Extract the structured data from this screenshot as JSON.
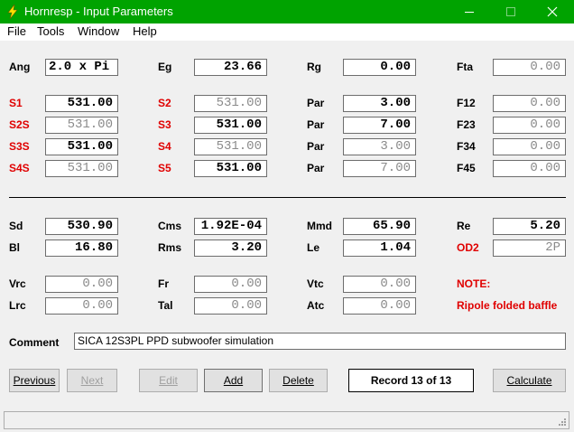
{
  "window": {
    "title": "Hornresp - Input Parameters"
  },
  "menu": [
    "File",
    "Tools",
    "Window",
    "Help"
  ],
  "params": {
    "ang": {
      "label": "Ang",
      "value": "2.0 x Pi"
    },
    "eg": {
      "label": "Eg",
      "value": "23.66"
    },
    "rg": {
      "label": "Rg",
      "value": "0.00"
    },
    "fta": {
      "label": "Fta",
      "value": "0.00"
    },
    "s1": {
      "label": "S1",
      "value": "531.00"
    },
    "s2": {
      "label": "S2",
      "value": "531.00"
    },
    "par1": {
      "label": "Par",
      "value": "3.00"
    },
    "f12": {
      "label": "F12",
      "value": "0.00"
    },
    "s2s": {
      "label": "S2S",
      "value": "531.00"
    },
    "s3": {
      "label": "S3",
      "value": "531.00"
    },
    "par2": {
      "label": "Par",
      "value": "7.00"
    },
    "f23": {
      "label": "F23",
      "value": "0.00"
    },
    "s3s": {
      "label": "S3S",
      "value": "531.00"
    },
    "s4": {
      "label": "S4",
      "value": "531.00"
    },
    "par3": {
      "label": "Par",
      "value": "3.00"
    },
    "f34": {
      "label": "F34",
      "value": "0.00"
    },
    "s4s": {
      "label": "S4S",
      "value": "531.00"
    },
    "s5": {
      "label": "S5",
      "value": "531.00"
    },
    "par4": {
      "label": "Par",
      "value": "7.00"
    },
    "f45": {
      "label": "F45",
      "value": "0.00"
    },
    "sd": {
      "label": "Sd",
      "value": "530.90"
    },
    "cms": {
      "label": "Cms",
      "value": "1.92E-04"
    },
    "mmd": {
      "label": "Mmd",
      "value": "65.90"
    },
    "re": {
      "label": "Re",
      "value": "5.20"
    },
    "bl": {
      "label": "Bl",
      "value": "16.80"
    },
    "rms": {
      "label": "Rms",
      "value": "3.20"
    },
    "le": {
      "label": "Le",
      "value": "1.04"
    },
    "od2": {
      "label": "OD2",
      "value": "2P"
    },
    "vrc": {
      "label": "Vrc",
      "value": "0.00"
    },
    "fr": {
      "label": "Fr",
      "value": "0.00"
    },
    "vtc": {
      "label": "Vtc",
      "value": "0.00"
    },
    "lrc": {
      "label": "Lrc",
      "value": "0.00"
    },
    "tal": {
      "label": "Tal",
      "value": "0.00"
    },
    "atc": {
      "label": "Atc",
      "value": "0.00"
    }
  },
  "note": {
    "label": "NOTE:",
    "text": "Ripole folded baffle"
  },
  "comment": {
    "label": "Comment",
    "value": "SICA 12S3PL PPD subwoofer simulation"
  },
  "buttons": {
    "previous": "Previous",
    "next": "Next",
    "edit": "Edit",
    "add": "Add",
    "delete": "Delete",
    "calculate": "Calculate"
  },
  "record": "Record 13 of 13",
  "colors": {
    "titlebar": "#00a300",
    "label_red": "#e00000"
  }
}
